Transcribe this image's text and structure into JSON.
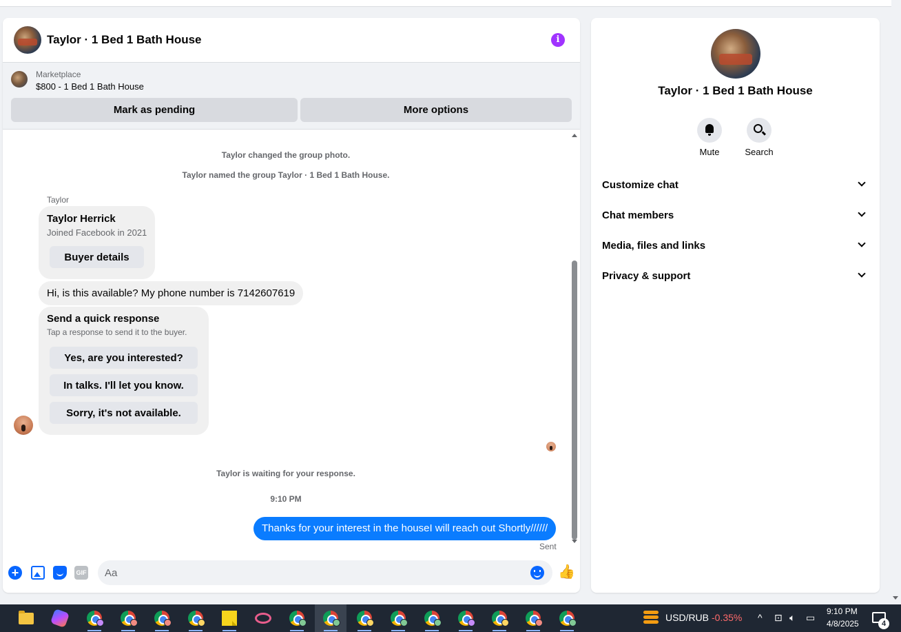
{
  "chat": {
    "title": "Taylor · 1 Bed 1 Bath House",
    "marketplace": {
      "label": "Marketplace",
      "listing": "$800 - 1 Bed 1 Bath House",
      "pending_button": "Mark as pending",
      "more_button": "More options"
    },
    "system_messages": [
      "Taylor changed the group photo.",
      "Taylor named the group Taylor · 1 Bed 1 Bath House."
    ],
    "sender_name": "Taylor",
    "profile_card": {
      "name": "Taylor Herrick",
      "joined": "Joined Facebook in 2021",
      "button": "Buyer details"
    },
    "incoming_message": "Hi, is this available? My phone number is 7142607619",
    "quick_response": {
      "title": "Send a quick response",
      "subtitle": "Tap a response to send it to the buyer.",
      "options": [
        "Yes, are you interested?",
        "In talks. I'll let you know.",
        "Sorry, it's not available."
      ]
    },
    "waiting_text": "Taylor is waiting for your response.",
    "timestamp": "9:10 PM",
    "outgoing_message": "Thanks for your interest in the houseI will reach out Shortly//////",
    "sent_status": "Sent",
    "composer": {
      "placeholder": "Aa",
      "gif_label": "GIF"
    }
  },
  "side_panel": {
    "title": "Taylor · 1 Bed 1 Bath House",
    "actions": [
      {
        "label": "Mute",
        "icon": "bell-icon"
      },
      {
        "label": "Search",
        "icon": "search-icon"
      }
    ],
    "sections": [
      "Customize chat",
      "Chat members",
      "Media, files and links",
      "Privacy & support"
    ]
  },
  "taskbar": {
    "ticker_label": "USD/RUB",
    "ticker_change": "-0.35%",
    "time": "9:10 PM",
    "date": "4/8/2025",
    "notification_count": "4",
    "apps": [
      "file-explorer",
      "copilot",
      "chrome",
      "chrome",
      "chrome",
      "chrome",
      "sticky-notes",
      "snipping-tool",
      "chrome",
      "chrome",
      "chrome",
      "chrome",
      "chrome",
      "chrome",
      "chrome",
      "chrome",
      "chrome"
    ]
  },
  "colors": {
    "accent": "#0866ff",
    "outgoing_bubble": "#0a7cff",
    "info": "#a033ff",
    "negative": "#ff6b6b"
  }
}
